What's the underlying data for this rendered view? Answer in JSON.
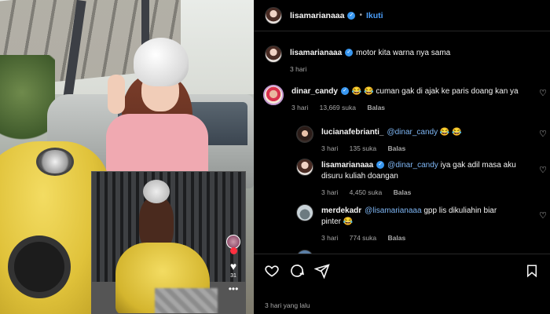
{
  "header": {
    "username": "lisamarianaaa",
    "separator": "•",
    "follow_label": "Ikuti",
    "more_icon": "more-horizontal-icon"
  },
  "caption": {
    "username": "lisamarianaaa",
    "text": "motor kita warna nya sama",
    "time": "3 hari"
  },
  "comments": [
    {
      "username": "dinar_candy",
      "verified": true,
      "text": "😂 😂 cuman gak di ajak ke paris doang kan ya",
      "time": "3 hari",
      "likes": "13,669 suka",
      "reply": "Balas"
    },
    {
      "username": "lucianafebrianti_",
      "verified": false,
      "mention": "@dinar_candy",
      "text": "😂 😂",
      "time": "3 hari",
      "likes": "135 suka",
      "reply": "Balas"
    },
    {
      "username": "lisamarianaaa",
      "verified": true,
      "mention": "@dinar_candy",
      "text": "iya gak adil masa aku disuru kuliah doangan",
      "time": "3 hari",
      "likes": "4,450 suka",
      "reply": "Balas"
    },
    {
      "username": "merdekadr",
      "verified": false,
      "mention": "@lisamarianaaa",
      "text": "gpp lis dikuliahin biar pinter 😂",
      "time": "3 hari",
      "likes": "774 suka",
      "reply": "Balas"
    }
  ],
  "reel": {
    "like_count": "31"
  },
  "footer": {
    "time": "3 hari yang lalu"
  },
  "colors": {
    "background": "#000000",
    "link": "#4a9df8",
    "verified": "#3897f0",
    "muted": "#a8a8a8"
  }
}
